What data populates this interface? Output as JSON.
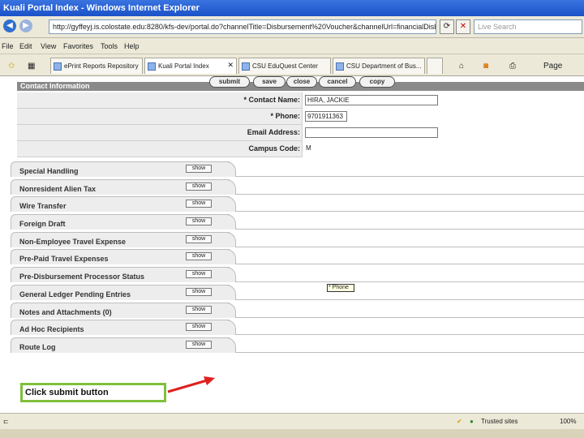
{
  "browser": {
    "title": "Kuali Portal Index - Windows Internet Explorer",
    "address": "http://gyffeyj.is.colostate.edu:8280/kfs-dev/portal.do?channelTitle=Disbursement%20Voucher&channelUrl=financialDisburseme",
    "search_placeholder": "Live Search",
    "menu": [
      "File",
      "Edit",
      "View",
      "Favorites",
      "Tools",
      "Help"
    ],
    "tabs": [
      "ePrint Reports Repository",
      "Kuali Portal Index",
      "CSU EduQuest Center",
      "CSU Department of Bus..."
    ],
    "page_menu": "Page"
  },
  "contact": {
    "section_title": "Contact Information",
    "fields": [
      {
        "label": "* Contact Name:",
        "value": "HIRA, JACKIE"
      },
      {
        "label": "* Phone:",
        "value": "9701911363"
      },
      {
        "label": "Email Address:",
        "value": ""
      },
      {
        "label": "Campus Code:",
        "value": "M"
      }
    ]
  },
  "tabs": {
    "show_label": "show",
    "items": [
      "Special Handling",
      "Nonresident Alien Tax",
      "Wire Transfer",
      "Foreign Draft",
      "Non-Employee Travel Expense",
      "Pre-Paid Travel Expenses",
      "Pre-Disbursement Processor Status",
      "General Ledger Pending Entries",
      "Notes and Attachments (0)",
      "Ad Hoc Recipients",
      "Route Log"
    ]
  },
  "tooltip": "* Phone",
  "actions": [
    "submit",
    "save",
    "close",
    "cancel",
    "copy"
  ],
  "callout": "Click submit button",
  "status": {
    "zone": "Trusted sites",
    "zoom": "100%"
  },
  "colors": {
    "callout_border": "#7fbf3a",
    "arrow": "#e02020"
  }
}
